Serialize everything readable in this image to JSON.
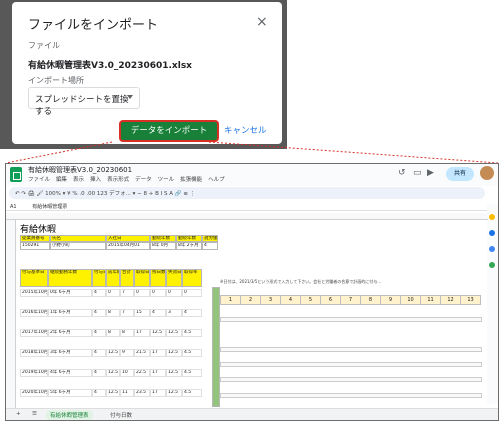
{
  "dialog": {
    "title": "ファイルをインポート",
    "close_symbol": "×",
    "file_label": "ファイル",
    "file_name": "有給休暇管理表V3.0_20230601.xlsx",
    "location_label": "インポート場所",
    "location_value": "スプレッドシートを置換する",
    "import_button": "データをインポート",
    "cancel_button": "キャンセル"
  },
  "sheet_window": {
    "doc_title": "有給休暇管理表V3.0_20230601",
    "menu": [
      "ファイル",
      "編集",
      "表示",
      "挿入",
      "表示形式",
      "データ",
      "ツール",
      "拡張機能",
      "ヘルプ"
    ],
    "share_label": "共有",
    "toolbar_text": "↶ ↷ 🖨 🖌 100% ▾ ¥ % .0 .00 123 デフォ... ▾ − 8 + B I S A 🔗 ≡ ⋮",
    "cell_ref": "A1",
    "formula": "有給休暇管理票",
    "sheet_title": "有給休暇",
    "header_labels": [
      "従業員番号",
      "氏名",
      "入社日",
      "勤続年数",
      "勤続年数",
      "週労働"
    ],
    "header_values": [
      "150291",
      "小野小町",
      "2015年04月01",
      "8年 0月",
      "8年 2ヶ月",
      "4"
    ],
    "col_headers": [
      "付与基準日",
      "継続勤務年数",
      "付与日数",
      "前年繰越",
      "合計",
      "取得日数",
      "残日数",
      "失効日数",
      "取得率"
    ],
    "data_rows": [
      {
        "date": "2015年10月01日",
        "years": "0年 6ヶ月",
        "granted": "4",
        "carry": "0",
        "total": "7",
        "used": "0",
        "left": "0",
        "expired": "0",
        "rate": "0"
      },
      {
        "date": "2016年10月01日",
        "years": "1年 6ヶ月",
        "granted": "4",
        "carry": "8",
        "total": "7",
        "used": "15",
        "left": "4",
        "expired": "3",
        "rate": "4"
      },
      {
        "date": "2017年10月01日",
        "years": "2年 6ヶ月",
        "granted": "4",
        "carry": "8",
        "total": "8",
        "used": "17",
        "left": "12.5",
        "expired": "12.5",
        "rate": "4.5"
      },
      {
        "date": "2018年10月01日",
        "years": "3年 6ヶ月",
        "granted": "4",
        "carry": "12.5",
        "total": "9",
        "used": "21.5",
        "left": "17",
        "expired": "12.5",
        "rate": "4.5"
      },
      {
        "date": "2019年10月01日",
        "years": "4年 6ヶ月",
        "granted": "4",
        "carry": "12.5",
        "total": "10",
        "used": "22.5",
        "left": "17",
        "expired": "12.5",
        "rate": "4.5"
      },
      {
        "date": "2020年10月01日",
        "years": "5年 6ヶ月",
        "granted": "4",
        "carry": "12.5",
        "total": "11",
        "used": "23.5",
        "left": "17",
        "expired": "12.5",
        "rate": "4.5"
      }
    ],
    "day_headers": [
      "1",
      "2",
      "3",
      "4",
      "5",
      "6",
      "7",
      "8",
      "9",
      "10",
      "11",
      "12",
      "13"
    ],
    "note_text": "※日付は、2021/3/5という形式で入力して下さい。会社と労働者の合意で計画的に付与…",
    "tabs": [
      "+",
      "☰",
      "有給休暇管理表",
      "付与日数"
    ],
    "colors": {
      "import_green": "#188038",
      "highlight_red": "#d93025",
      "header_yellow": "#fff200",
      "header_green": "#93c47d"
    }
  }
}
